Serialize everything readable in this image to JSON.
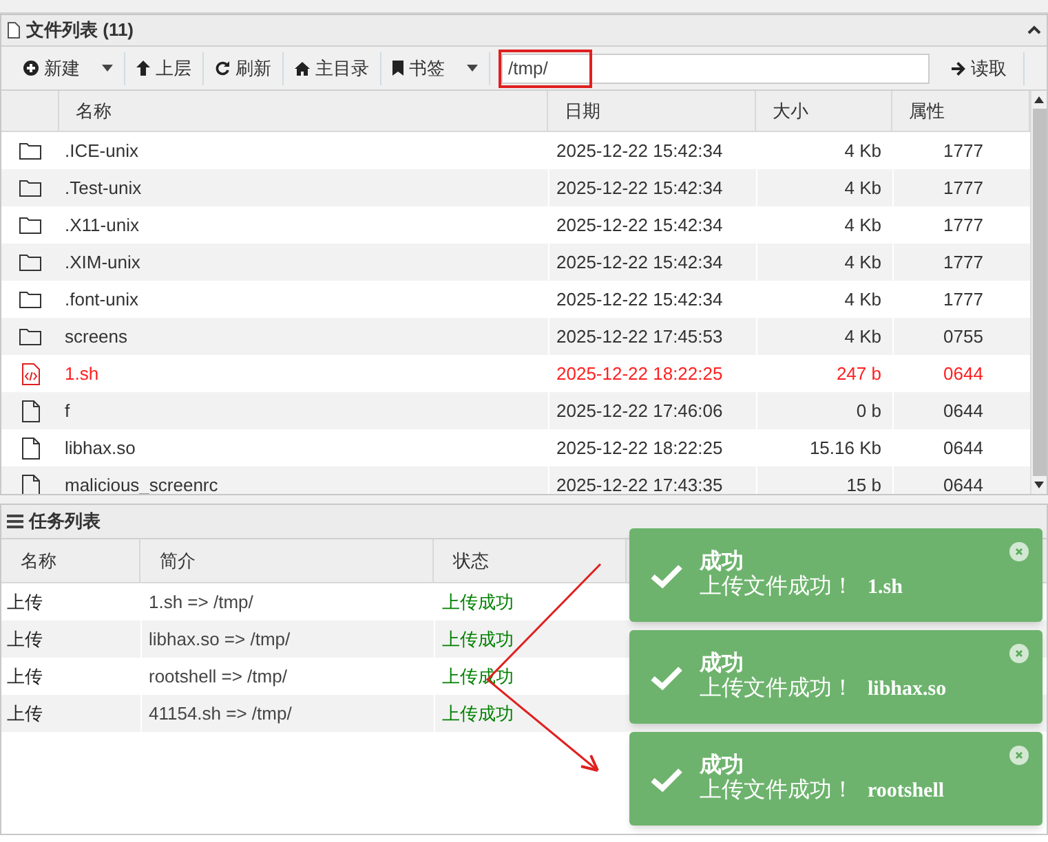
{
  "file_panel": {
    "title": "文件列表 (11)",
    "toolbar": [
      {
        "label": "新建",
        "kind": "dropdown"
      },
      {
        "label": "上层",
        "kind": "button"
      },
      {
        "label": "刷新",
        "kind": "button"
      },
      {
        "label": "主目录",
        "kind": "button"
      },
      {
        "label": "书签",
        "kind": "dropdown"
      }
    ],
    "path": "/tmp/",
    "read_button": "读取",
    "columns": [
      "名称",
      "日期",
      "大小",
      "属性"
    ],
    "rows": [
      {
        "kind": "folder",
        "name": ".ICE-unix",
        "date": "2025-12-22 15:42:34",
        "size": "4 Kb",
        "mode": "1777",
        "highlighted": false
      },
      {
        "kind": "folder",
        "name": ".Test-unix",
        "date": "2025-12-22 15:42:34",
        "size": "4 Kb",
        "mode": "1777",
        "highlighted": false
      },
      {
        "kind": "folder",
        "name": ".X11-unix",
        "date": "2025-12-22 15:42:34",
        "size": "4 Kb",
        "mode": "1777",
        "highlighted": false
      },
      {
        "kind": "folder",
        "name": ".XIM-unix",
        "date": "2025-12-22 15:42:34",
        "size": "4 Kb",
        "mode": "1777",
        "highlighted": false
      },
      {
        "kind": "folder",
        "name": ".font-unix",
        "date": "2025-12-22 15:42:34",
        "size": "4 Kb",
        "mode": "1777",
        "highlighted": false
      },
      {
        "kind": "folder",
        "name": "screens",
        "date": "2025-12-22 17:45:53",
        "size": "4 Kb",
        "mode": "0755",
        "highlighted": false
      },
      {
        "kind": "code",
        "name": "1.sh",
        "date": "2025-12-22 18:22:25",
        "size": "247 b",
        "mode": "0644",
        "highlighted": true
      },
      {
        "kind": "file",
        "name": "f",
        "date": "2025-12-22 17:46:06",
        "size": "0 b",
        "mode": "0644",
        "highlighted": false
      },
      {
        "kind": "file",
        "name": "libhax.so",
        "date": "2025-12-22 18:22:25",
        "size": "15.16 Kb",
        "mode": "0644",
        "highlighted": false
      },
      {
        "kind": "file",
        "name": "malicious_screenrc",
        "date": "2025-12-22 17:43:35",
        "size": "15 b",
        "mode": "0644",
        "highlighted": false
      }
    ]
  },
  "task_panel": {
    "title": "任务列表",
    "columns": [
      "名称",
      "简介",
      "状态"
    ],
    "rows": [
      {
        "name": "上传",
        "summary": "1.sh => /tmp/",
        "status": "上传成功"
      },
      {
        "name": "上传",
        "summary": "libhax.so => /tmp/",
        "status": "上传成功"
      },
      {
        "name": "上传",
        "summary": "rootshell => /tmp/",
        "status": "上传成功"
      },
      {
        "name": "上传",
        "summary": "41154.sh => /tmp/",
        "status": "上传成功"
      }
    ]
  },
  "toasts": [
    {
      "title": "成功",
      "message": "上传文件成功！",
      "file": "1.sh"
    },
    {
      "title": "成功",
      "message": "上传文件成功！",
      "file": "libhax.so"
    },
    {
      "title": "成功",
      "message": "上传文件成功！",
      "file": "rootshell"
    }
  ]
}
